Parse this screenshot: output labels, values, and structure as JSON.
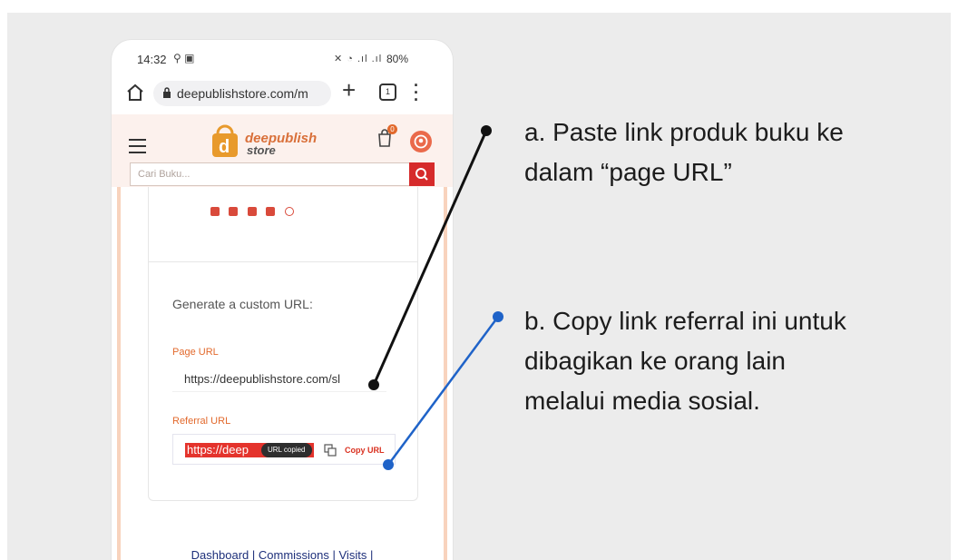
{
  "status_bar": {
    "time": "14:32",
    "battery": "80%"
  },
  "browser": {
    "address": "deepublishstore.com/m",
    "tab_count": "1"
  },
  "site": {
    "logo_line1": "deepublish",
    "logo_line2": "store",
    "cart_count": "0",
    "search_placeholder": "Cari Buku..."
  },
  "affiliate": {
    "heading": "Generate a custom URL:",
    "page_url_label": "Page URL",
    "page_url_value": "https://deepublishstore.com/sl",
    "referral_url_label": "Referral URL",
    "referral_url_value": "https://deep",
    "copied_tooltip": "URL copied",
    "copy_button": "Copy URL"
  },
  "footer": {
    "link_dashboard": "Dashboard",
    "link_commissions": "Commissions",
    "link_visits": "Visits"
  },
  "annotations": {
    "a_line1": "a. Paste link produk buku ke",
    "a_line2": "dalam “page URL”",
    "b_line1": "b. Copy link referral ini untuk",
    "b_line2": "dibagikan ke orang lain",
    "b_line3": "melalui media sosial."
  },
  "colors": {
    "brand_orange": "#e2692c",
    "search_button": "#d62b2b",
    "link_blue": "#1d2f7a",
    "connector_a": "#111111",
    "connector_b": "#1f63c8"
  }
}
